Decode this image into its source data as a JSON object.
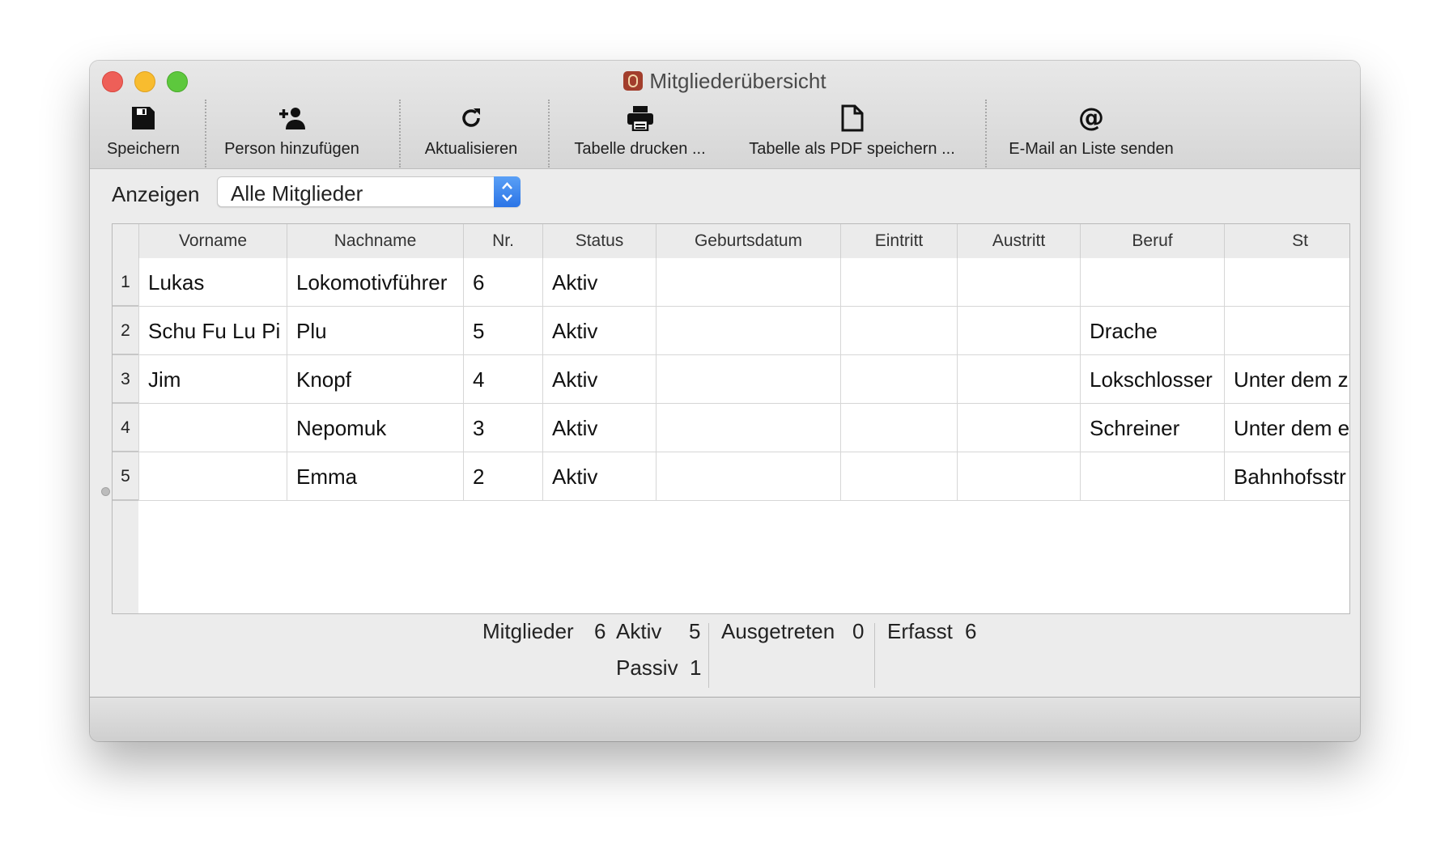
{
  "window": {
    "title": "Mitgliederübersicht"
  },
  "toolbar": {
    "save": "Speichern",
    "add_person": "Person hinzufügen",
    "refresh": "Aktualisieren",
    "print_table": "Tabelle drucken ...",
    "save_pdf": "Tabelle als PDF speichern ...",
    "email_list": "E-Mail an Liste senden"
  },
  "filter": {
    "label": "Anzeigen",
    "selected": "Alle Mitglieder"
  },
  "table": {
    "columns": [
      "Vorname",
      "Nachname",
      "Nr.",
      "Status",
      "Geburtsdatum",
      "Eintritt",
      "Austritt",
      "Beruf",
      "St"
    ],
    "row_numbers": [
      "1",
      "2",
      "3",
      "4",
      "5"
    ],
    "rows": [
      [
        "Lukas",
        "Lokomotivführer",
        "6",
        "Aktiv",
        "",
        "",
        "",
        "",
        ""
      ],
      [
        "Schu Fu Lu Pi",
        "Plu",
        "5",
        "Aktiv",
        "",
        "",
        "",
        "Drache",
        ""
      ],
      [
        "Jim",
        "Knopf",
        "4",
        "Aktiv",
        "",
        "",
        "",
        "Lokschlosser",
        "Unter dem z"
      ],
      [
        "",
        "Nepomuk",
        "3",
        "Aktiv",
        "",
        "",
        "",
        "Schreiner",
        "Unter dem e"
      ],
      [
        "",
        "Emma",
        "2",
        "Aktiv",
        "",
        "",
        "",
        "",
        "Bahnhofsstr"
      ]
    ]
  },
  "stats": {
    "members_label": "Mitglieder",
    "members_value": "6",
    "active_label": "Aktiv",
    "active_value": "5",
    "passive_label": "Passiv",
    "passive_value": "1",
    "left_label": "Ausgetreten",
    "left_value": "0",
    "recorded_label": "Erfasst",
    "recorded_value": "6"
  },
  "icons": {
    "save": "floppy-disk-icon",
    "add_person": "person-add-icon",
    "refresh": "refresh-icon",
    "print": "printer-icon",
    "pdf": "document-icon",
    "email": "at-sign-icon"
  },
  "colors": {
    "close": "#ee5f58",
    "minimize": "#f8bc2f",
    "maximize": "#5dc83d",
    "accent": "#2b74e6"
  }
}
